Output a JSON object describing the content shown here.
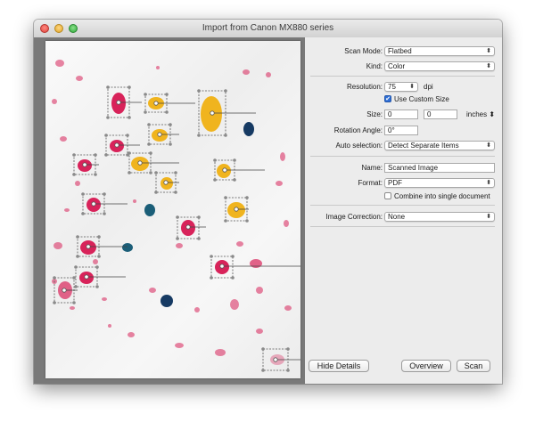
{
  "window": {
    "title": "Import from Canon MX880 series"
  },
  "settings": {
    "scan_mode_label": "Scan Mode:",
    "scan_mode_value": "Flatbed",
    "kind_label": "Kind:",
    "kind_value": "Color",
    "resolution_label": "Resolution:",
    "resolution_value": "75",
    "resolution_unit": "dpi",
    "custom_size_label": "Use Custom Size",
    "custom_size_checked": true,
    "size_label": "Size:",
    "size_width": "0",
    "size_height": "0",
    "size_unit": "inches",
    "rotation_label": "Rotation Angle:",
    "rotation_value": "0°",
    "auto_selection_label": "Auto selection:",
    "auto_selection_value": "Detect Separate Items",
    "name_label": "Name:",
    "name_value": "Scanned Image",
    "format_label": "Format:",
    "format_value": "PDF",
    "combine_label": "Combine into single document",
    "combine_checked": false,
    "image_correction_label": "Image Correction:",
    "image_correction_value": "None"
  },
  "buttons": {
    "hide_details": "Hide Details",
    "overview": "Overview",
    "scan": "Scan"
  },
  "icons": {
    "popup_arrow": "⬍",
    "stepper": "⬍",
    "checkmark": "✔"
  },
  "colors": {
    "magenta": "#d8235a",
    "yellow": "#f0b41e",
    "navy": "#163a63",
    "teal": "#1b5e78"
  }
}
